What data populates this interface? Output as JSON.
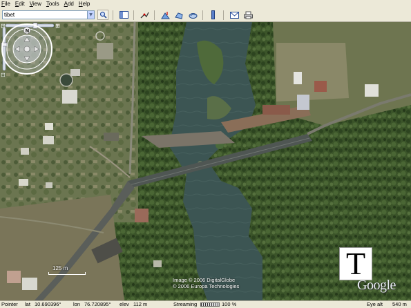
{
  "menu": [
    "File",
    "Edit",
    "View",
    "Tools",
    "Add",
    "Help"
  ],
  "search": {
    "value": "tibet",
    "placeholder": ""
  },
  "toolbar": {
    "icons": [
      "search-go-icon",
      "sidebar-toggle-icon",
      "tour-icon",
      "placemark-icon",
      "polygon-icon",
      "path-icon",
      "ruler-icon",
      "email-icon",
      "print-icon"
    ]
  },
  "map": {
    "scale_label": "125 m",
    "copyright_line1": "Image © 2006 DigitalGlobe",
    "copyright_line2": "© 2006 Europa Technologies",
    "logo": "Google",
    "tile_letter": "T"
  },
  "status": {
    "pointer_label": "Pointer",
    "lat_label": "lat",
    "lat_value": "10.690396°",
    "lon_label": "lon",
    "lon_value": "76.720895°",
    "elev_label": "elev",
    "elev_value": "112 m",
    "streaming_label": "Streaming",
    "streaming_percent": "100 %",
    "eye_alt_label": "Eye alt",
    "eye_alt_value": "540 m"
  },
  "colors": {
    "vegetation": "#3f5a2c",
    "river": "#39514f",
    "road": "#5a5e5a",
    "chrome": "#ece9d8"
  }
}
